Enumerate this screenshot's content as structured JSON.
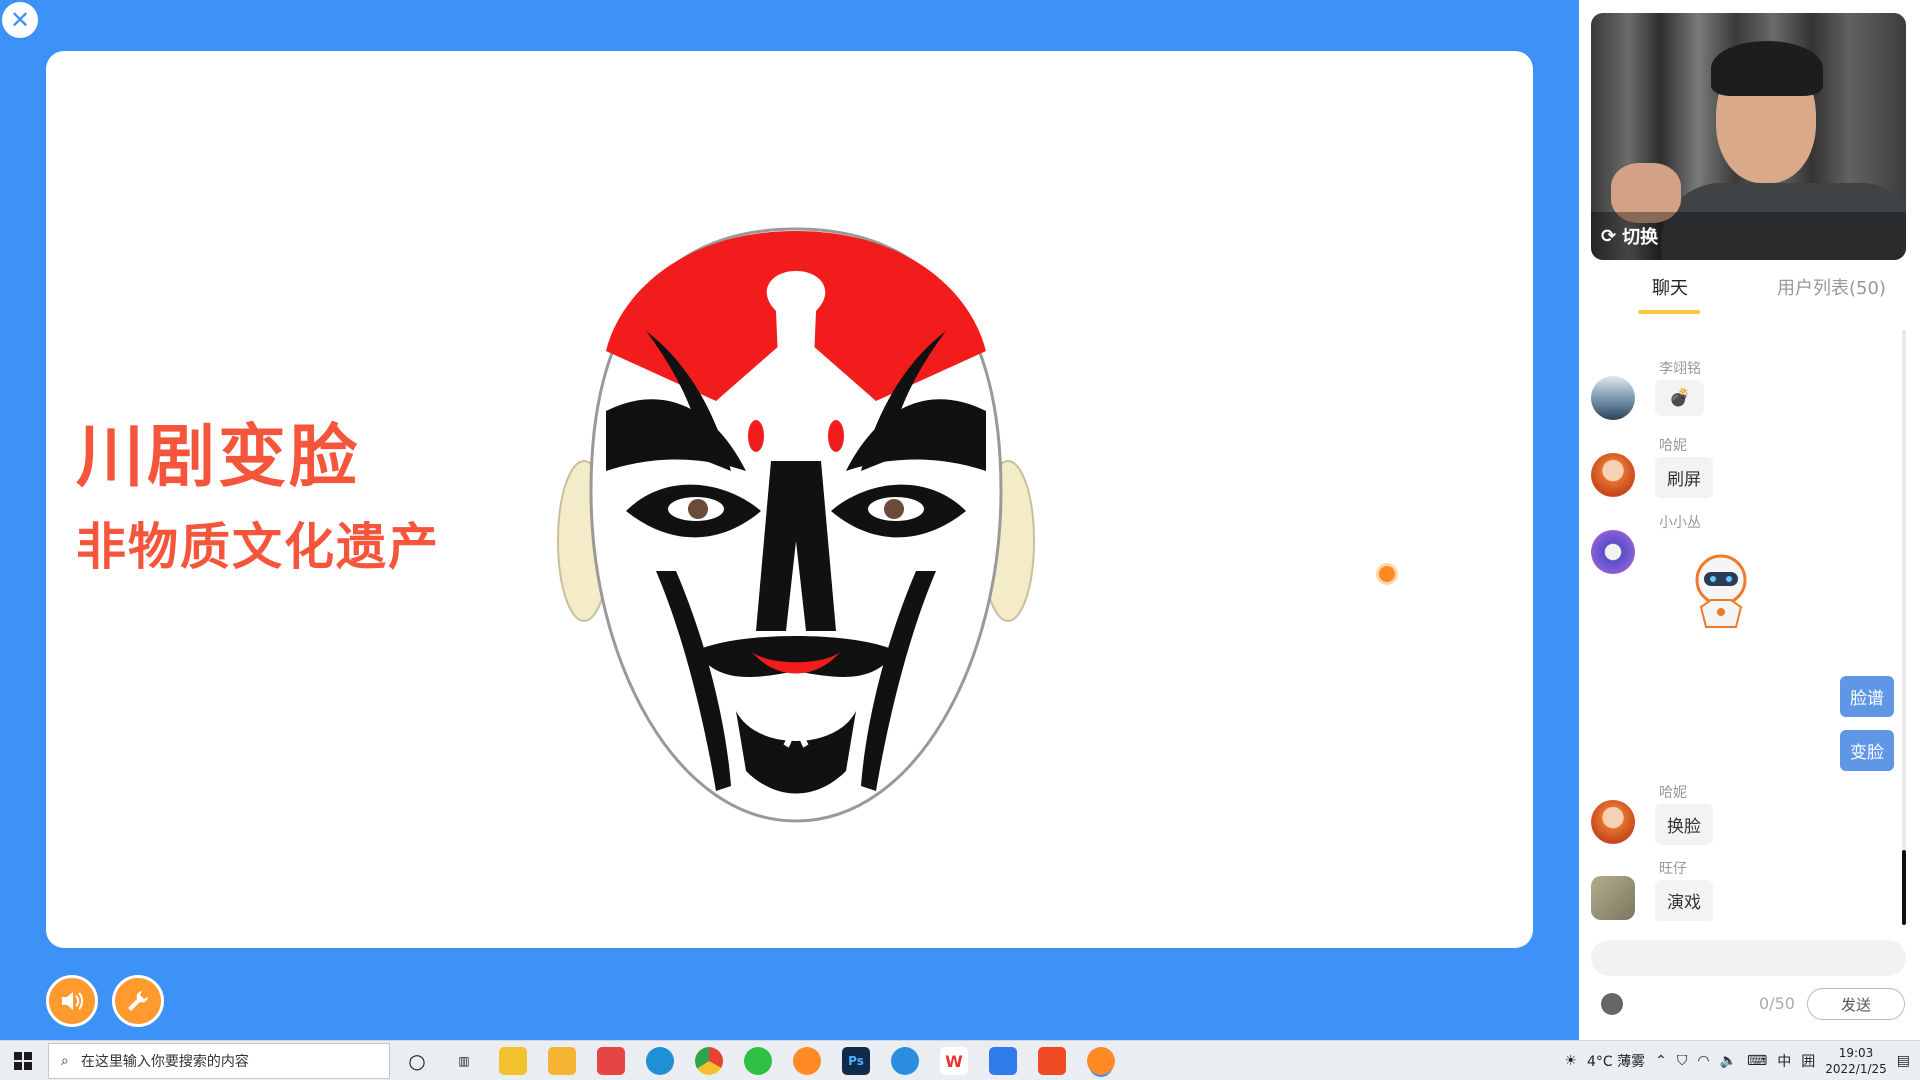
{
  "slide": {
    "title": "川剧变脸",
    "subtitle": "非物质文化遗产"
  },
  "video": {
    "switch_label": "切换"
  },
  "tabs": {
    "chat": "聊天",
    "users": "用户列表(50)"
  },
  "chat": {
    "messages": [
      {
        "nick": "李翊铭",
        "text": "",
        "emoji": "bomb"
      },
      {
        "nick": "哈妮",
        "text": "刷屏"
      },
      {
        "nick": "小小丛",
        "text": "",
        "sticker": "robot"
      },
      {
        "mine": true,
        "text": "脸谱"
      },
      {
        "mine": true,
        "text": "变脸"
      },
      {
        "nick": "哈妮",
        "text": "换脸"
      },
      {
        "nick": "旺仔",
        "text": "演戏"
      }
    ],
    "counter": "0/50",
    "send_label": "发送",
    "input_placeholder": ""
  },
  "taskbar": {
    "search_placeholder": "在这里输入你要搜索的内容",
    "weather": "4°C 薄雾",
    "ime": "中",
    "ime_mode": "囲",
    "time": "19:03",
    "date": "2022/1/25"
  },
  "colors": {
    "stage_blue": "#3d92f7",
    "title_red": "#f5553a",
    "accent_orange": "#ff9a2e",
    "tab_underline": "#ffc93a",
    "my_bubble": "#5f97e6"
  }
}
